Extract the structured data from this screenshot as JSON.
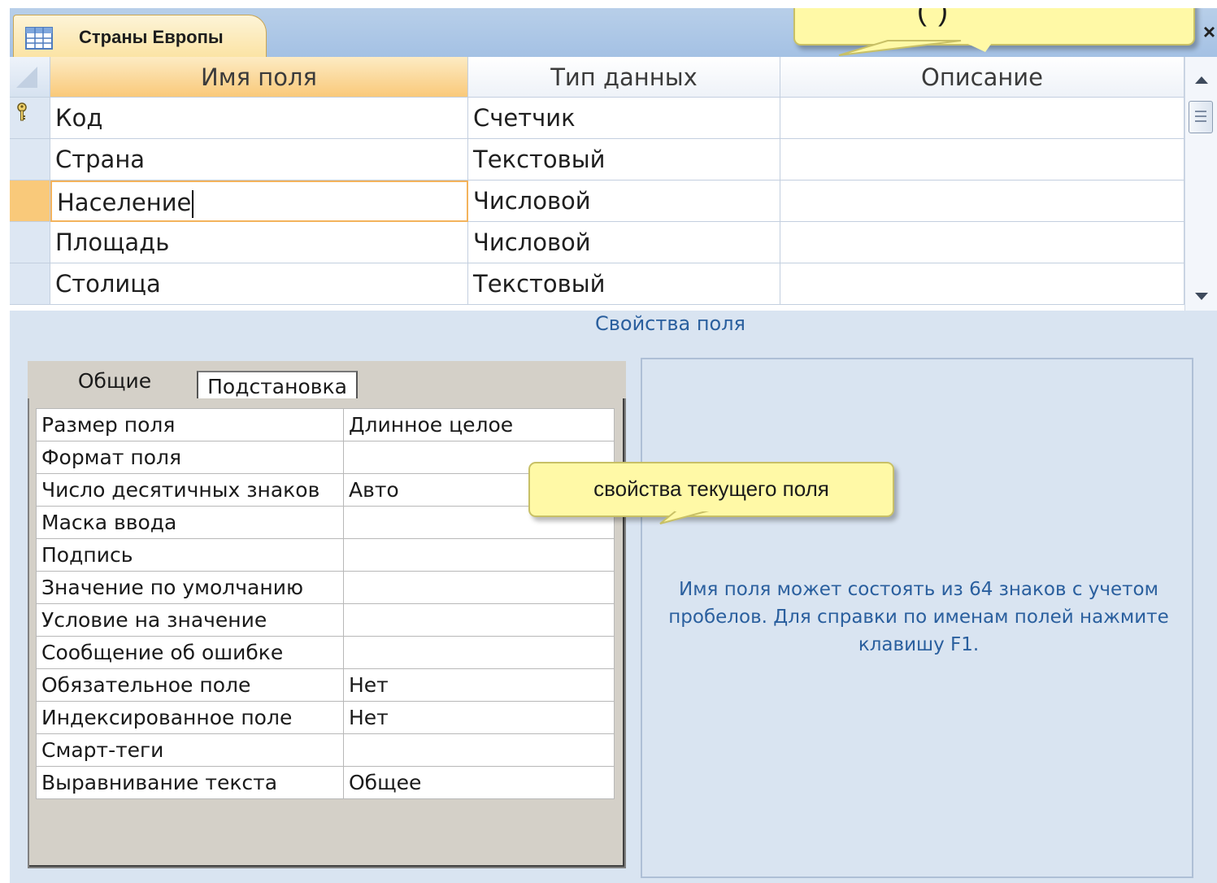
{
  "window": {
    "tab_title": "Страны Европы",
    "close_glyph": "×"
  },
  "grid": {
    "headers": [
      "Имя поля",
      "Тип данных",
      "Описание"
    ],
    "rows": [
      {
        "name": "Код",
        "type": "Счетчик",
        "description": "",
        "primary_key": true
      },
      {
        "name": "Страна",
        "type": "Текстовый",
        "description": ""
      },
      {
        "name": "Население",
        "type": "Числовой",
        "description": "",
        "current": true
      },
      {
        "name": "Площадь",
        "type": "Числовой",
        "description": ""
      },
      {
        "name": "Столица",
        "type": "Текстовый",
        "description": ""
      }
    ]
  },
  "properties": {
    "section_title": "Свойства поля",
    "tabs": [
      "Общие",
      "Подстановка"
    ],
    "items": [
      {
        "label": "Размер поля",
        "value": "Длинное целое"
      },
      {
        "label": "Формат поля",
        "value": ""
      },
      {
        "label": "Число десятичных знаков",
        "value": "Авто"
      },
      {
        "label": "Маска ввода",
        "value": ""
      },
      {
        "label": "Подпись",
        "value": ""
      },
      {
        "label": "Значение по умолчанию",
        "value": ""
      },
      {
        "label": "Условие на значение",
        "value": ""
      },
      {
        "label": "Сообщение об ошибке",
        "value": ""
      },
      {
        "label": "Обязательное поле",
        "value": "Нет"
      },
      {
        "label": "Индексированное поле",
        "value": "Нет"
      },
      {
        "label": "Смарт-теги",
        "value": ""
      },
      {
        "label": "Выравнивание текста",
        "value": "Общее"
      }
    ],
    "help_text": "Имя поля может состоять из 64 знаков с учетом пробелов.  Для справки по именам полей нажмите клавишу F1."
  },
  "callouts": {
    "top_fragment": "(        )",
    "current_field_props": "свойства текущего поля"
  },
  "colors": {
    "accent_orange": "#f9c97a",
    "tab_strip": "#a4c1e4",
    "panel_bg": "#d9e4f1",
    "callout_bg": "#fff9a6",
    "help_text": "#2a5f9e"
  }
}
